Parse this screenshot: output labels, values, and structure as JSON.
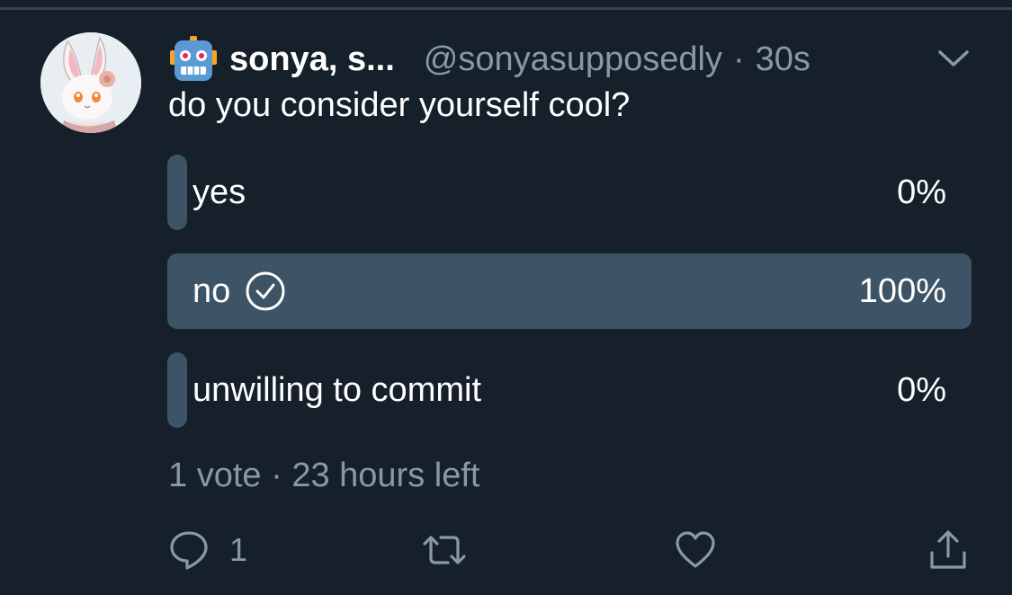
{
  "tweet": {
    "display_name": "sonya, s...",
    "handle": "@sonyasupposedly",
    "separator": "·",
    "time": "30s",
    "text": "do you consider yourself cool?"
  },
  "poll": {
    "options": [
      {
        "label": "yes",
        "percent": "0%",
        "fill": 0.0,
        "selected": false
      },
      {
        "label": "no",
        "percent": "100%",
        "fill": 1.0,
        "selected": true
      },
      {
        "label": "unwilling to commit",
        "percent": "0%",
        "fill": 0.0,
        "selected": false
      }
    ],
    "votes": "1 vote",
    "separator": "·",
    "time_left": "23 hours left"
  },
  "actions": {
    "reply_count": "1"
  },
  "icons": {
    "avatar": "bunny-avatar",
    "emoji": "robot-emoji-icon",
    "menu": "chevron-down-icon",
    "selected": "check-circle-icon",
    "reply": "reply-icon",
    "retweet": "retweet-icon",
    "like": "heart-icon",
    "share": "share-icon"
  },
  "colors": {
    "background": "#15202b",
    "muted": "#8899a6",
    "poll_bar": "#3d5466"
  }
}
